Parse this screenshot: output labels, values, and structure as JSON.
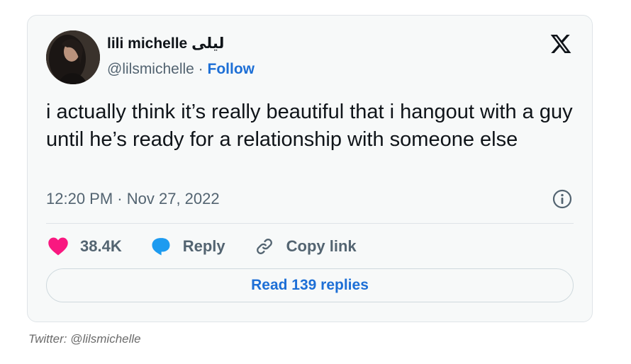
{
  "tweet": {
    "author_name": "lili michelle ليلى",
    "handle": "@lilsmichelle",
    "separator": " · ",
    "follow_label": "Follow",
    "text": "i actually think it’s really beautiful that i hangout with a guy until he’s ready for a relationship with someone else",
    "time": "12:20 PM",
    "date": "Nov 27, 2022",
    "likes_count": "38.4K",
    "reply_label": "Reply",
    "copy_link_label": "Copy link",
    "read_replies_label": "Read 139 replies"
  },
  "icons": {
    "logo": "x-logo-icon",
    "info": "info-icon",
    "like": "heart-icon",
    "reply": "reply-bubble-icon",
    "copy": "link-icon"
  },
  "colors": {
    "heart": "#f91880",
    "reply_bubble": "#1d9bf0",
    "link_blue": "#1d6fd6",
    "secondary_text": "#536471",
    "card_background": "#f7f9f9"
  },
  "caption": "Twitter: @lilsmichelle"
}
